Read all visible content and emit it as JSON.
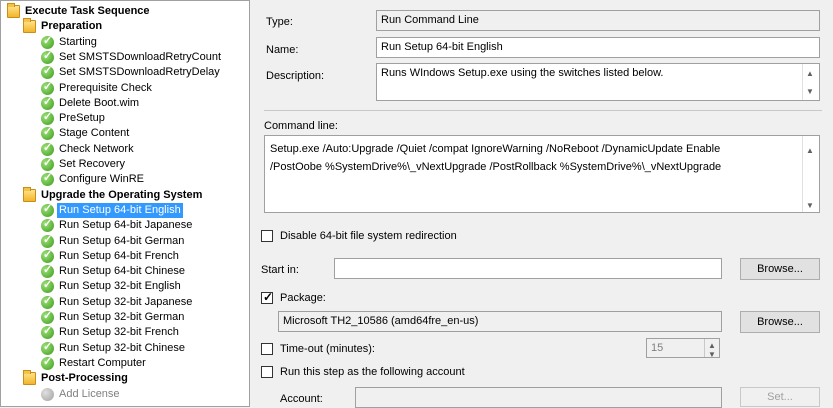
{
  "tree": {
    "root": "Execute Task Sequence",
    "groups": [
      {
        "label": "Preparation",
        "items": [
          "Starting",
          "Set SMSTSDownloadRetryCount",
          "Set SMSTSDownloadRetryDelay",
          "Prerequisite Check",
          "Delete Boot.wim",
          "PreSetup",
          "Stage Content",
          "Check Network",
          "Set Recovery",
          "Configure WinRE"
        ]
      },
      {
        "label": "Upgrade the Operating System",
        "items": [
          "Run Setup 64-bit English",
          "Run Setup 64-bit Japanese",
          "Run Setup 64-bit German",
          "Run Setup 64-bit French",
          "Run Setup 64-bit Chinese",
          "Run Setup 32-bit English",
          "Run Setup 32-bit Japanese",
          "Run Setup 32-bit German",
          "Run Setup 32-bit French",
          "Run Setup 32-bit Chinese",
          "Restart Computer"
        ]
      },
      {
        "label": "Post-Processing",
        "items": [
          "Add License"
        ]
      }
    ],
    "selected": "Run Setup 64-bit English"
  },
  "props": {
    "type_label": "Type:",
    "type_value": "Run Command Line",
    "name_label": "Name:",
    "name_value": "Run Setup 64-bit English",
    "desc_label": "Description:",
    "desc_value": "Runs WIndows Setup.exe using the switches listed below.",
    "cmd_label": "Command line:",
    "cmd_line1": "Setup.exe /Auto:Upgrade /Quiet /compat IgnoreWarning /NoReboot /DynamicUpdate Enable",
    "cmd_line2": "/PostOobe %SystemDrive%\\_vNextUpgrade /PostRollback %SystemDrive%\\_vNextUpgrade",
    "disable_redirect_label": "Disable 64-bit file system redirection",
    "start_in_label": "Start in:",
    "start_in_value": "",
    "browse_label": "Browse...",
    "package_label": "Package:",
    "package_value": "Microsoft TH2_10586 (amd64fre_en-us)",
    "timeout_label": "Time-out (minutes):",
    "timeout_value": "15",
    "run_as_label": "Run this step as the following account",
    "account_label": "Account:",
    "account_value": "",
    "set_label": "Set..."
  }
}
